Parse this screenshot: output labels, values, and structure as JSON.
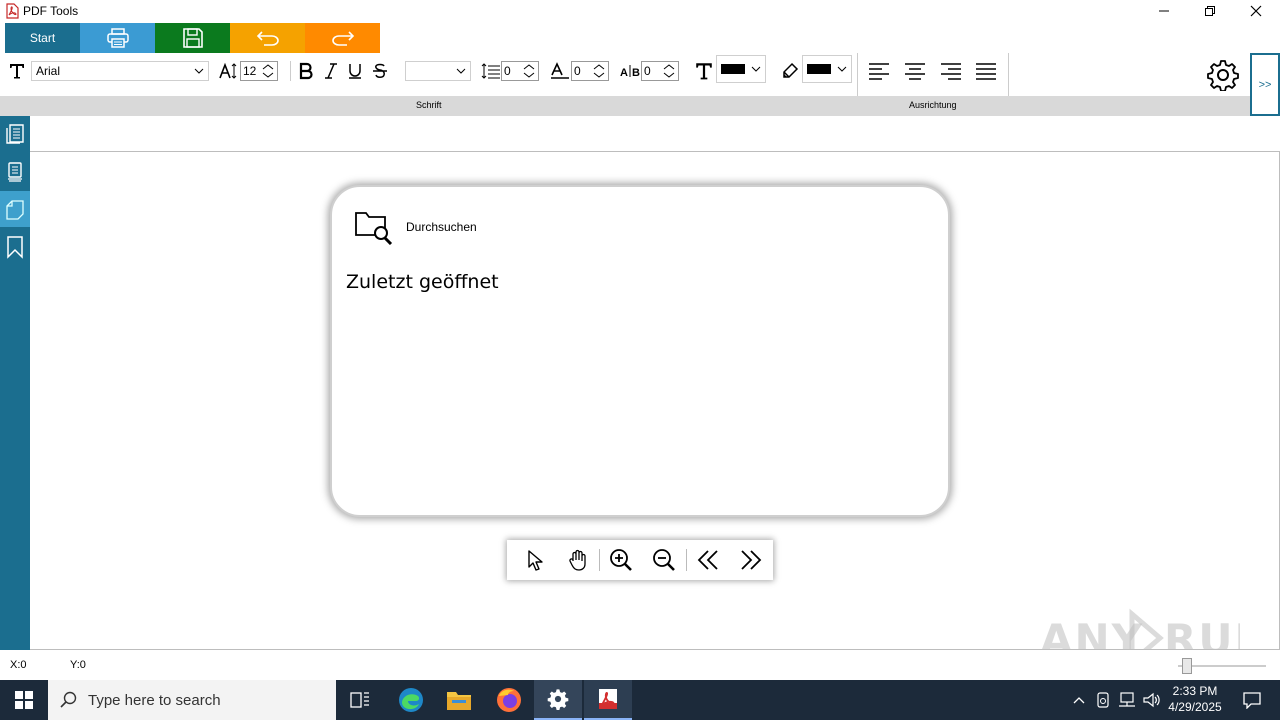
{
  "window": {
    "title": "PDF Tools"
  },
  "quickbar": {
    "start_label": "Start",
    "colors": {
      "start": "#1b6e8f",
      "print": "#3b9bd3",
      "save": "#0b7a1e",
      "undo": "#f5a200",
      "redo": "#ff8a00"
    }
  },
  "ribbon": {
    "font_name": "Arial",
    "font_size": "12",
    "style_select_value": "",
    "line_spacing": "0",
    "char_height": "0",
    "char_spacing": "0",
    "group_font_label": "Schrift",
    "group_align_label": "Ausrichtung",
    "collapse_label": ">>"
  },
  "start_page": {
    "browse_label": "Durchsuchen",
    "recent_title": "Zuletzt geöffnet"
  },
  "statusbar": {
    "x_readout": "X:0",
    "y_readout": "Y:0"
  },
  "taskbar": {
    "search_placeholder": "Type here to search",
    "time": "2:33 PM",
    "date": "4/29/2025"
  },
  "watermark": "ANY RUN",
  "colors": {
    "nav_bg": "#1b6e8f",
    "ribbon_label_bg": "#d9d9d9",
    "taskbar_bg": "#1c2a3a"
  }
}
